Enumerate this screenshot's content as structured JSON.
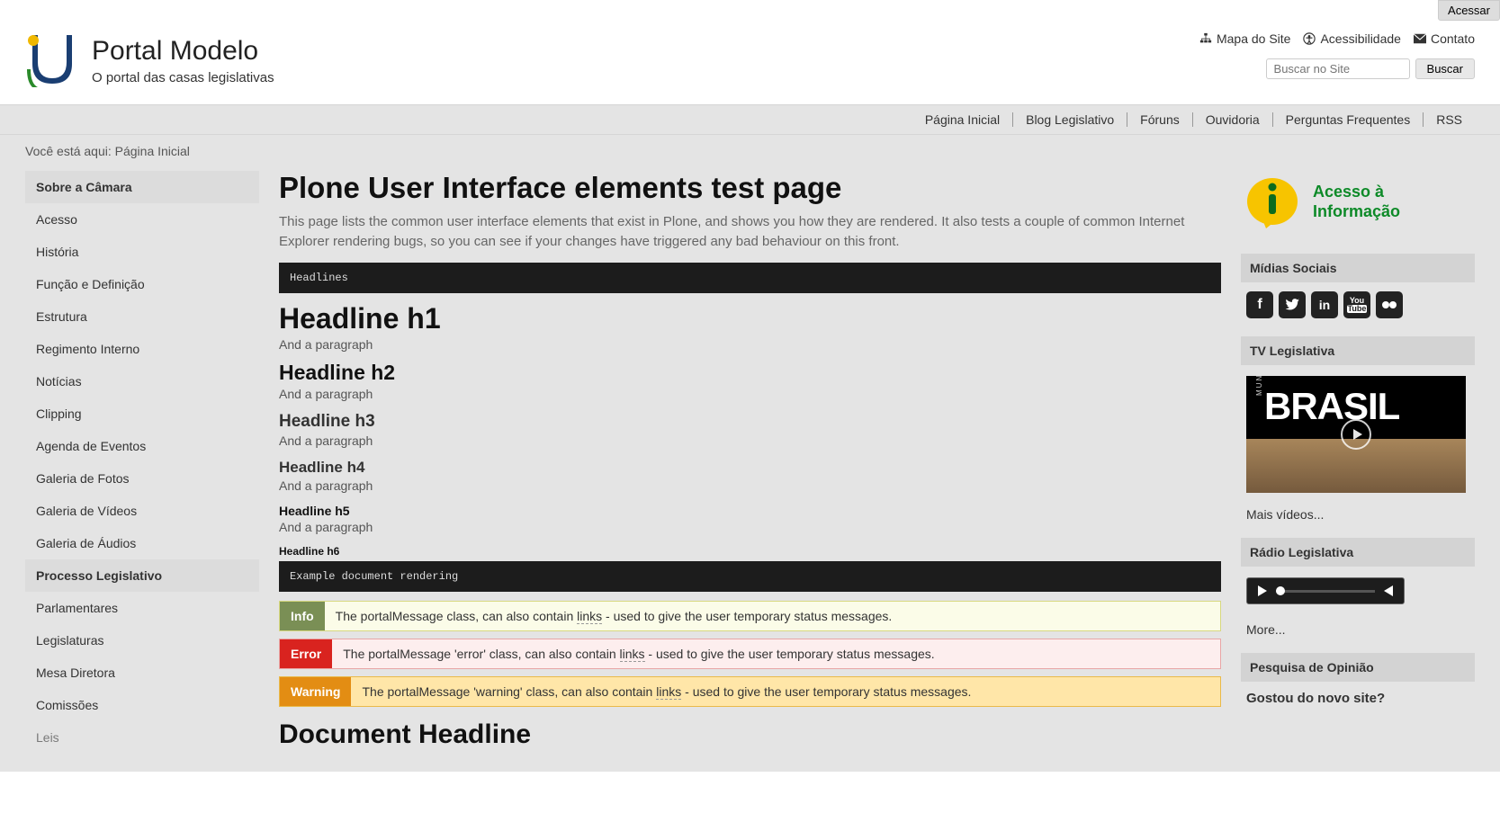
{
  "topbar": {
    "acessar": "Acessar"
  },
  "brand": {
    "title": "Portal Modelo",
    "subtitle": "O portal das casas legislativas"
  },
  "meta_links": {
    "sitemap": "Mapa do Site",
    "accessibility": "Acessibilidade",
    "contact": "Contato"
  },
  "search": {
    "placeholder": "Buscar no Site",
    "button": "Buscar"
  },
  "nav": [
    "Página Inicial",
    "Blog Legislativo",
    "Fóruns",
    "Ouvidoria",
    "Perguntas Frequentes",
    "RSS"
  ],
  "breadcrumb": {
    "prefix": "Você está aqui:",
    "current": "Página Inicial"
  },
  "sidebar_left": {
    "section1_title": "Sobre a Câmara",
    "section1_items": [
      "Acesso",
      "História",
      "Função e Definição",
      "Estrutura",
      "Regimento Interno",
      "Notícias",
      "Clipping",
      "Agenda de Eventos",
      "Galeria de Fotos",
      "Galeria de Vídeos",
      "Galeria de Áudios"
    ],
    "section2_title": "Processo Legislativo",
    "section2_items": [
      "Parlamentares",
      "Legislaturas",
      "Mesa Diretora",
      "Comissões",
      "Leis"
    ]
  },
  "main": {
    "title": "Plone User Interface elements test page",
    "description": "This page lists the common user interface elements that exist in Plone, and shows you how they are rendered. It also tests a couple of common Internet Explorer rendering bugs, so you can see if your changes have triggered any bad behaviour on this front.",
    "code1": "Headlines",
    "h1": "Headline h1",
    "p1": "And a paragraph",
    "h2": "Headline h2",
    "p2": "And a paragraph",
    "h3": "Headline h3",
    "p3": "And a paragraph",
    "h4": "Headline h4",
    "p4": "And a paragraph",
    "h5": "Headline h5",
    "p5": "And a paragraph",
    "h6": "Headline h6",
    "code2": "Example document rendering",
    "msg_info": {
      "badge": "Info",
      "text_a": "The portalMessage class, can also contain ",
      "link": "links",
      "text_b": " - used to give the user temporary status messages."
    },
    "msg_error": {
      "badge": "Error",
      "text_a": "The portalMessage 'error' class, can also contain ",
      "link": "links",
      "text_b": " - used to give the user temporary status messages."
    },
    "msg_warning": {
      "badge": "Warning",
      "text_a": "The portalMessage 'warning' class, can also contain ",
      "link": "links",
      "text_b": " - used to give the user temporary status messages."
    },
    "doc_headline": "Document Headline"
  },
  "sidebar_right": {
    "acesso": {
      "line1": "Acesso à",
      "line2": "Informação"
    },
    "social_title": "Mídias Sociais",
    "tv_title": "TV Legislativa",
    "tv_brand": "BRASIL",
    "tv_municipio": "MUNICÍPIO",
    "tv_more": "Mais vídeos...",
    "radio_title": "Rádio Legislativa",
    "radio_more": "More...",
    "poll_title": "Pesquisa de Opinião",
    "poll_question": "Gostou do novo site?"
  }
}
